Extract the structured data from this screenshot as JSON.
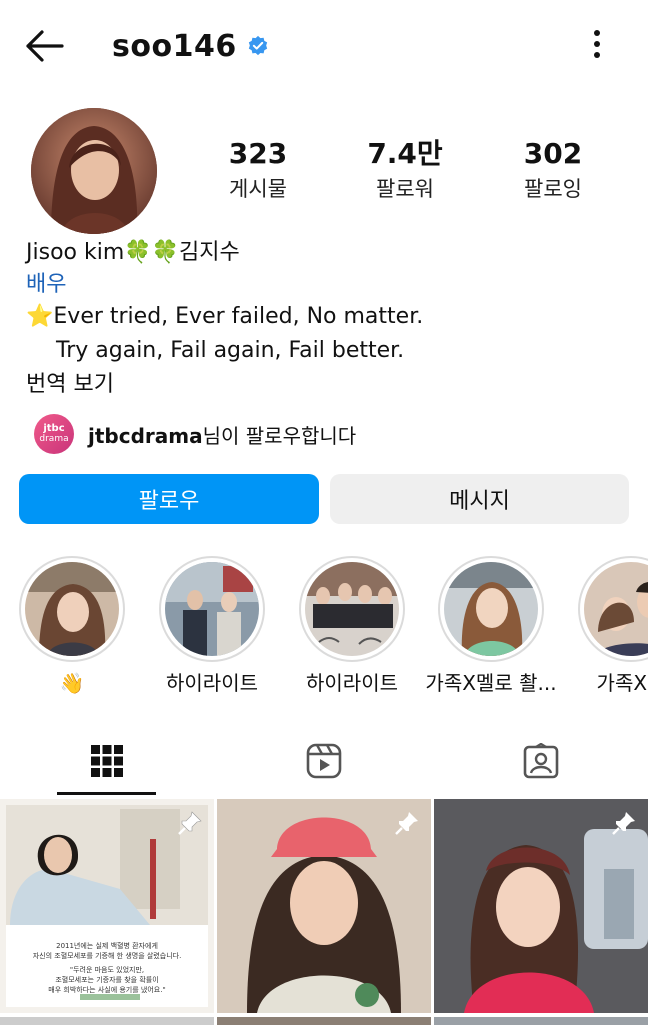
{
  "header": {
    "username": "soo146",
    "back_icon": "arrow-left-icon",
    "verified_icon": "verified-badge-icon",
    "more_icon": "more-vertical-icon"
  },
  "stats": [
    {
      "value": "323",
      "label": "게시물"
    },
    {
      "value": "7.4만",
      "label": "팔로워"
    },
    {
      "value": "302",
      "label": "팔로잉"
    }
  ],
  "bio": {
    "name": "Jisoo kim🍀🍀김지수",
    "category": "배우",
    "line1": "⭐Ever tried, Ever failed, No matter.",
    "line2": "Try again, Fail again, Fail better.",
    "translate": "번역 보기"
  },
  "followed_by": {
    "logo_line1": "jtbc",
    "logo_line2": "drama",
    "account": "jtbcdrama",
    "suffix": "님이 팔로우합니다"
  },
  "actions": {
    "follow_label": "팔로우",
    "message_label": "메시지"
  },
  "highlights": [
    {
      "label": "👋"
    },
    {
      "label": "하이라이트"
    },
    {
      "label": "하이라이트"
    },
    {
      "label": "가족X멜로 촬..."
    },
    {
      "label": "가족X멜"
    }
  ],
  "tabs": [
    {
      "icon": "grid-icon",
      "active": true
    },
    {
      "icon": "reels-icon",
      "active": false
    },
    {
      "icon": "tagged-icon",
      "active": false
    }
  ],
  "posts": [
    {
      "pinned": true,
      "text_lines": [
        "2011년에는 실제 백혈병 환자에게",
        "자신의 조혈모세포를 기증해 한 생명을 살렸습니다.",
        "\"두려운 마음도 있었지만,",
        "조혈모세포는 기증자를 찾을 확률이",
        "매우 희박하다는 사실에 용기를 냈어요.\""
      ]
    },
    {
      "pinned": true,
      "text_lines": []
    },
    {
      "pinned": true,
      "text_lines": []
    }
  ],
  "colors": {
    "accent": "#0095f6",
    "verified": "#3897f0",
    "category": "#1e63b8",
    "button_secondary": "#efefef"
  }
}
